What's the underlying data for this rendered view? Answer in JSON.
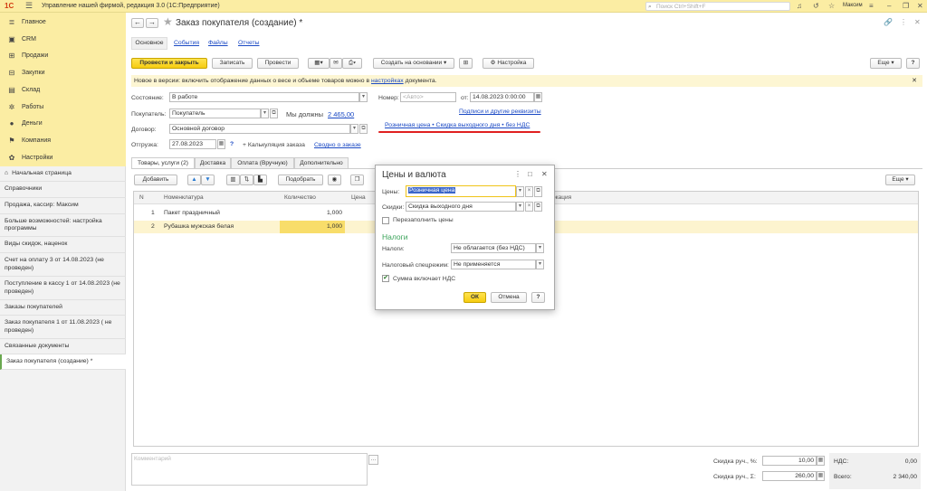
{
  "titlebar": {
    "logo": "1С",
    "app_title": "Управление нашей фирмой, редакция 3.0  (1С:Предприятие)",
    "search_placeholder": "Поиск Ctrl+Shift+F",
    "user": "Максим"
  },
  "sidebar": {
    "items": [
      {
        "label": "Главное",
        "icon": "list-icon"
      },
      {
        "label": "CRM",
        "icon": "crm-icon"
      },
      {
        "label": "Продажи",
        "icon": "cart-icon"
      },
      {
        "label": "Закупки",
        "icon": "purchase-icon"
      },
      {
        "label": "Склад",
        "icon": "warehouse-icon"
      },
      {
        "label": "Работы",
        "icon": "tools-icon"
      },
      {
        "label": "Деньги",
        "icon": "money-icon"
      },
      {
        "label": "Компания",
        "icon": "flag-icon"
      },
      {
        "label": "Настройки",
        "icon": "gear-icon"
      }
    ]
  },
  "history": {
    "items": [
      "Начальная страница",
      "Справочники",
      "Продажа, кассир: Максим",
      "Больше возможностей: настройка программы",
      "Виды скидок, наценок",
      "Счет на оплату 3 от 14.08.2023 (не проведен)",
      "Поступление в кассу 1 от 14.08.2023 (не проведен)",
      "Заказы покупателей",
      "Заказ покупателя 1 от 11.08.2023 ( не проведен)",
      "Связанные документы",
      "Заказ покупателя (создание) *"
    ]
  },
  "doc": {
    "title": "Заказ покупателя (создание) *",
    "subtabs": [
      "Основное",
      "События",
      "Файлы",
      "Отчеты"
    ],
    "toolbar": {
      "post_close": "Провести и закрыть",
      "save": "Записать",
      "post": "Провести",
      "create_based": "Создать на основании",
      "settings": "Настройка",
      "more": "Еще"
    },
    "info": {
      "text": "Новое в версии: включить отображение данных о весе и объеме товаров можно в",
      "link": "настройках",
      "tail": "документа."
    },
    "fields": {
      "state_label": "Состояние:",
      "state_value": "В работе",
      "buyer_label": "Покупатель:",
      "buyer_value": "Покупатель",
      "owe_label": "Мы должны",
      "owe_value": "2 465,00",
      "contract_label": "Договор:",
      "contract_value": "Основной договор",
      "ship_label": "Отгрузка:",
      "ship_value": "27.08.2023",
      "calc": "Калькуляция заказа",
      "summary": "Сводно о заказе",
      "num_label": "Номер:",
      "num_placeholder": "<Авто>",
      "from_label": "от:",
      "date_value": "14.08.2023  0:00:00",
      "sign_link": "Подписи и другие реквизиты",
      "price_link": "Розничная цена • Скидка выходного дня • без НДС"
    },
    "tabs": [
      "Товары, услуги (2)",
      "Доставка",
      "Оплата (Вручную)",
      "Дополнительно"
    ],
    "grid": {
      "add": "Добавить",
      "pick": "Подобрать",
      "more": "Еще",
      "headers": [
        "N",
        "Номенклатура",
        "Количество",
        "Цена",
        "ркация"
      ],
      "rows": [
        {
          "n": "1",
          "name": "Пакет праздничный",
          "qty": "1,000"
        },
        {
          "n": "2",
          "name": "Рубашка мужская белая",
          "qty": "1,000"
        }
      ]
    },
    "footer": {
      "comment_placeholder": "Комментарий",
      "disc_pct_label": "Скидка руч., %:",
      "disc_pct": "10,00",
      "disc_sum_label": "Скидка руч., Σ:",
      "disc_sum": "260,00",
      "vat_label": "НДС:",
      "vat": "0,00",
      "total_label": "Всего:",
      "total": "2 340,00"
    }
  },
  "dialog": {
    "title": "Цены и валюта",
    "prices_label": "Цены:",
    "prices_value": "Розничная цена",
    "discounts_label": "Скидки:",
    "discounts_value": "Скидка выходного дня",
    "refill": "Перезаполнить цены",
    "taxes_title": "Налоги",
    "tax_label": "Налоги:",
    "tax_value": "Не облагается (без НДС)",
    "regime_label": "Налоговый спецрежим:",
    "regime_value": "Не применяется",
    "vat_included": "Сумма включает НДС",
    "ok": "ОК",
    "cancel": "Отмена",
    "help": "?"
  },
  "colors": {
    "sidebar_bg": "#fbeda3",
    "primary_button": "#f6cc11",
    "link": "#1a49c4",
    "underline_red": "#e02020",
    "section_green": "#3aa35a"
  }
}
